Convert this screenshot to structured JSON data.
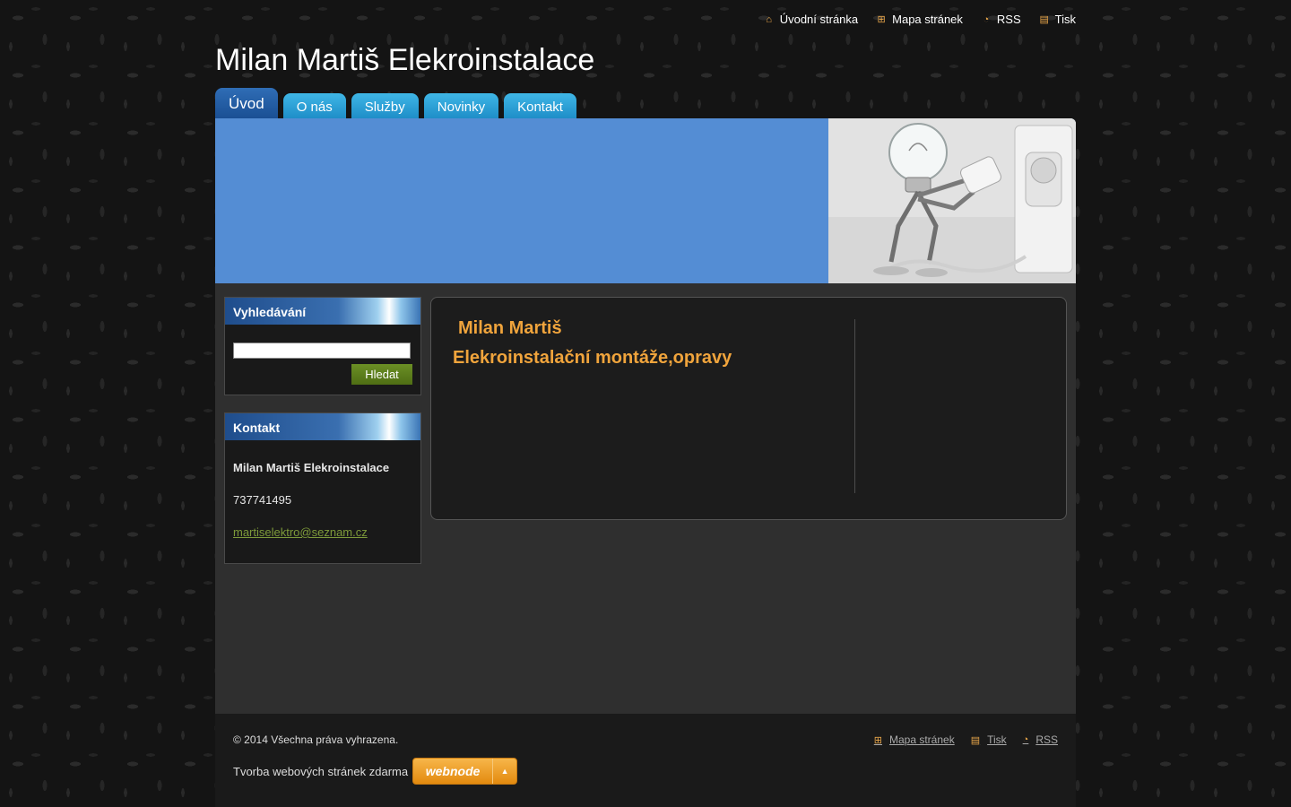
{
  "top_links": [
    {
      "label": "Úvodní stránka",
      "icon": "home-icon"
    },
    {
      "label": "Mapa stránek",
      "icon": "sitemap-icon"
    },
    {
      "label": "RSS",
      "icon": "rss-icon"
    },
    {
      "label": "Tisk",
      "icon": "print-icon"
    }
  ],
  "site_title": "Milan Martiš Elekroinstalace",
  "nav_tabs": [
    {
      "label": "Úvod",
      "active": true
    },
    {
      "label": "O nás"
    },
    {
      "label": "Služby"
    },
    {
      "label": "Novinky"
    },
    {
      "label": "Kontakt"
    }
  ],
  "search": {
    "heading": "Vyhledávání",
    "input_value": "",
    "button_label": "Hledat"
  },
  "contact": {
    "heading": "Kontakt",
    "name": "Milan Martiš Elekroinstalace",
    "phone": "737741495",
    "email": "martiselektro@seznam.cz"
  },
  "content": {
    "title": "Milan Martiš",
    "subtitle": "Elekroinstalační montáže,opravy"
  },
  "footer": {
    "copyright": "© 2014 Všechna práva vyhrazena.",
    "links": [
      {
        "label": "Mapa stránek",
        "icon": "sitemap-icon"
      },
      {
        "label": "Tisk",
        "icon": "print-icon"
      },
      {
        "label": "RSS",
        "icon": "rss-icon"
      }
    ],
    "webnode_text": "Tvorba webových stránek zdarma",
    "webnode_logo": "webnode"
  },
  "colors": {
    "banner": "#548dd4",
    "accent_orange": "#f0a43c",
    "tab_blue": "#2a9fd6",
    "tab_active": "#2a5fa8",
    "button_green": "#5f7f1c"
  }
}
